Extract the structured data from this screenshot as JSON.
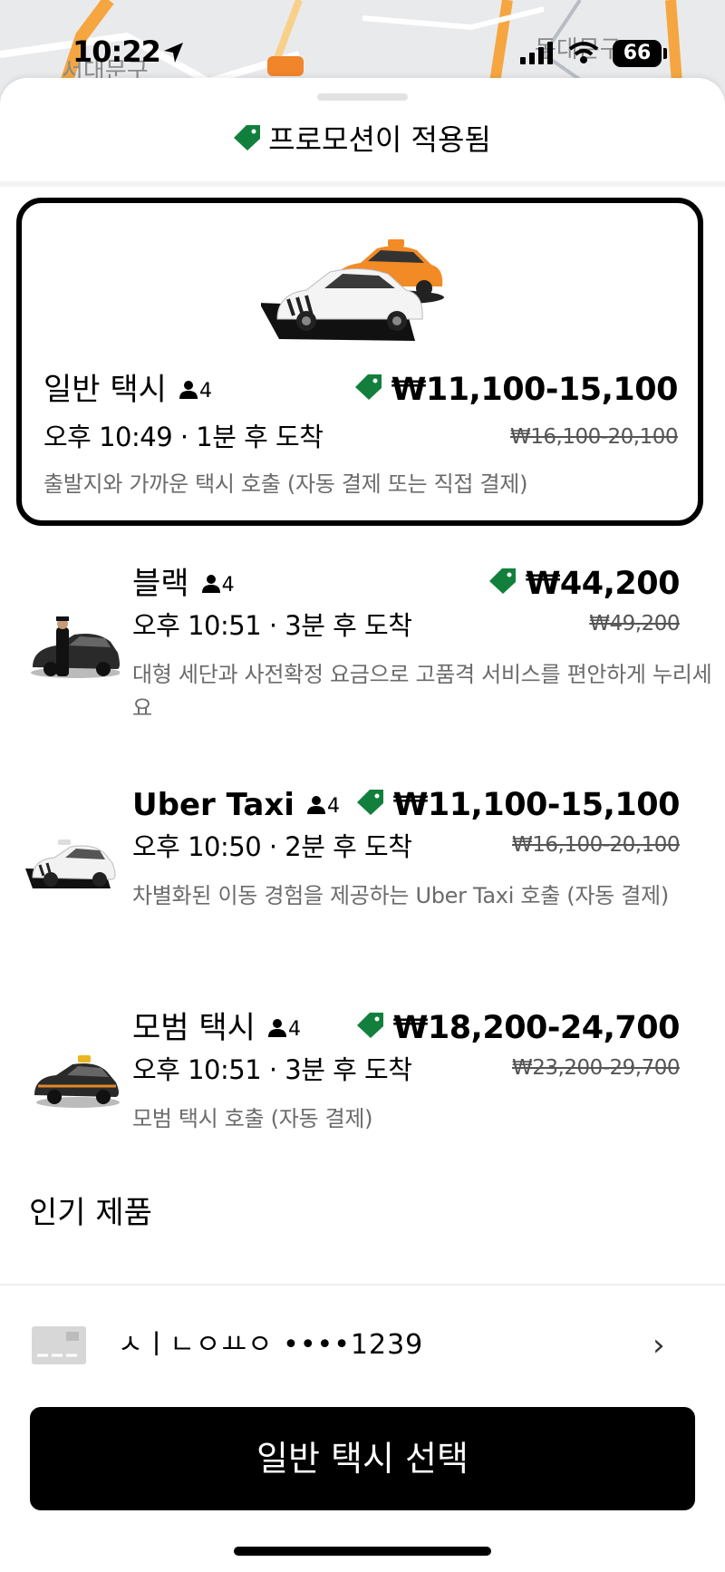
{
  "status_bar": {
    "time": "10:22",
    "battery": "66",
    "map_label_left": "서대문구",
    "map_label_right": "동대문구"
  },
  "promo": {
    "text": "프로모션이 적용됨",
    "tag_color": "#12803c"
  },
  "rides": [
    {
      "name": "일반 택시",
      "capacity": "4",
      "price": "₩11,100-15,100",
      "original_price": "₩16,100-20,100",
      "eta": "오후 10:49 · 1분 후 도착",
      "description": "출발지와 가까운 택시 호출 (자동 결제 또는 직접 결제)",
      "selected": true
    },
    {
      "name": "블랙",
      "capacity": "4",
      "price": "₩44,200",
      "original_price": "₩49,200",
      "eta": "오후 10:51 · 3분 후 도착",
      "description": "대형 세단과 사전확정 요금으로 고품격 서비스를 편안하게 누리세요"
    },
    {
      "name": "Uber Taxi",
      "capacity": "4",
      "price": "₩11,100-15,100",
      "original_price": "₩16,100-20,100",
      "eta": "오후 10:50 · 2분 후 도착",
      "description": "차별화된 이동 경험을 제공하는 Uber Taxi 호출 (자동 결제)"
    },
    {
      "name": "모범 택시",
      "capacity": "4",
      "price": "₩18,200-24,700",
      "original_price": "₩23,200-29,700",
      "eta": "오후 10:51 · 3분 후 도착",
      "description": "모범 택시 호출 (자동 결제)"
    }
  ],
  "popular_header": "인기 제품",
  "payment": {
    "label": "ㅅㅣㄴㅇㅛㅇ ••••1239",
    "chevron": "›"
  },
  "confirm_button": "일반 택시 선택",
  "colors": {
    "promo_green": "#12803c",
    "button_bg": "#000000"
  },
  "icons": [
    "location-arrow-icon",
    "signal-icon",
    "wifi-icon",
    "battery-icon",
    "promo-tag-icon",
    "person-icon",
    "card-icon",
    "chevron-right-icon"
  ]
}
